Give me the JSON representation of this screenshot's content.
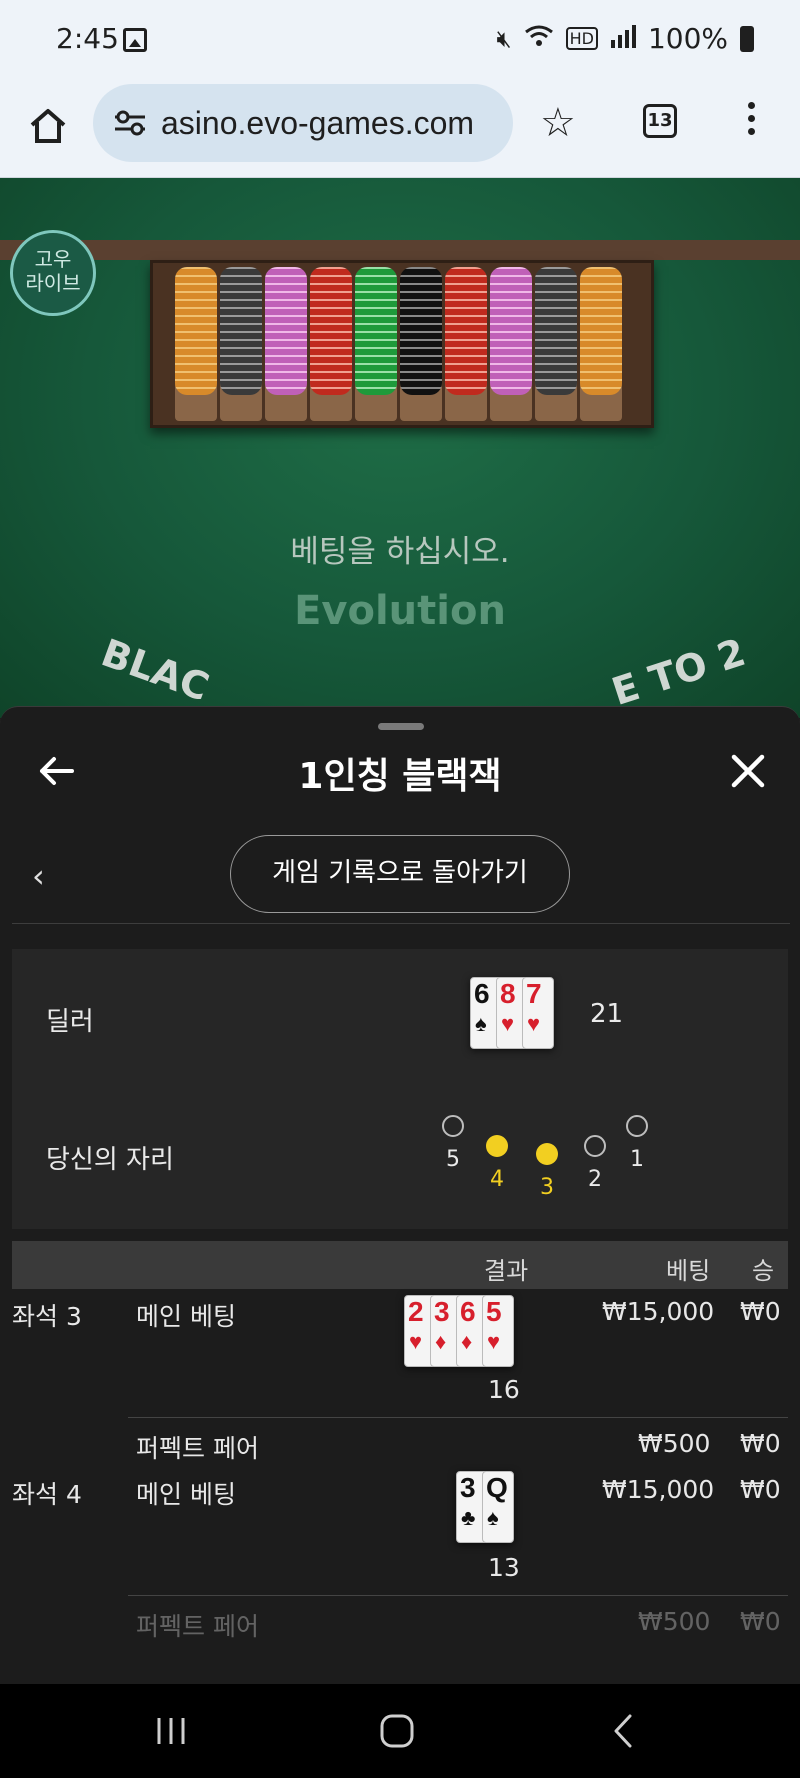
{
  "status_bar": {
    "time": "2:45",
    "battery": "100%"
  },
  "browser": {
    "url": "asino.evo-games.com",
    "tab_count": "13"
  },
  "game": {
    "badge_line1": "고우",
    "badge_line2": "라이브",
    "message": "베팅을 하십시오.",
    "brand": "Evolution",
    "felt_left": "BLAC",
    "felt_right": "E TO 2"
  },
  "panel": {
    "title": "1인칭 블랙잭",
    "back_history_label": "게임 기록으로 돌아가기",
    "dealer_label": "딜러",
    "dealer_cards": [
      {
        "rank": "6",
        "suit": "♠",
        "color": "black"
      },
      {
        "rank": "8",
        "suit": "♥",
        "color": "red"
      },
      {
        "rank": "7",
        "suit": "♥",
        "color": "red"
      }
    ],
    "dealer_total": "21",
    "your_seat_label": "당신의 자리",
    "seats": [
      {
        "num": "5",
        "active": false
      },
      {
        "num": "4",
        "active": true
      },
      {
        "num": "3",
        "active": true
      },
      {
        "num": "2",
        "active": false
      },
      {
        "num": "1",
        "active": false
      }
    ],
    "columns": {
      "result": "결과",
      "bet": "베팅",
      "win": "승"
    },
    "rows": [
      {
        "seat": "좌석 3",
        "bets": [
          {
            "type": "메인 베팅",
            "cards": [
              {
                "rank": "2",
                "suit": "♥",
                "color": "red"
              },
              {
                "rank": "3",
                "suit": "♦",
                "color": "red"
              },
              {
                "rank": "6",
                "suit": "♦",
                "color": "red"
              },
              {
                "rank": "5",
                "suit": "♥",
                "color": "red"
              }
            ],
            "total": "16",
            "bet": "₩15,000",
            "win": "₩0"
          },
          {
            "type": "퍼펙트 페어",
            "bet": "₩500",
            "win": "₩0"
          }
        ]
      },
      {
        "seat": "좌석 4",
        "bets": [
          {
            "type": "메인 베팅",
            "cards": [
              {
                "rank": "3",
                "suit": "♣",
                "color": "black"
              },
              {
                "rank": "Q",
                "suit": "♠",
                "color": "black"
              }
            ],
            "total": "13",
            "bet": "₩15,000",
            "win": "₩0"
          },
          {
            "type": "퍼펙트 페어",
            "bet": "₩500",
            "win": "₩0"
          }
        ]
      }
    ]
  },
  "colors": {
    "felt": "#1a6341",
    "accent": "#f2cf21",
    "panel_bg": "#1c1c1c"
  }
}
